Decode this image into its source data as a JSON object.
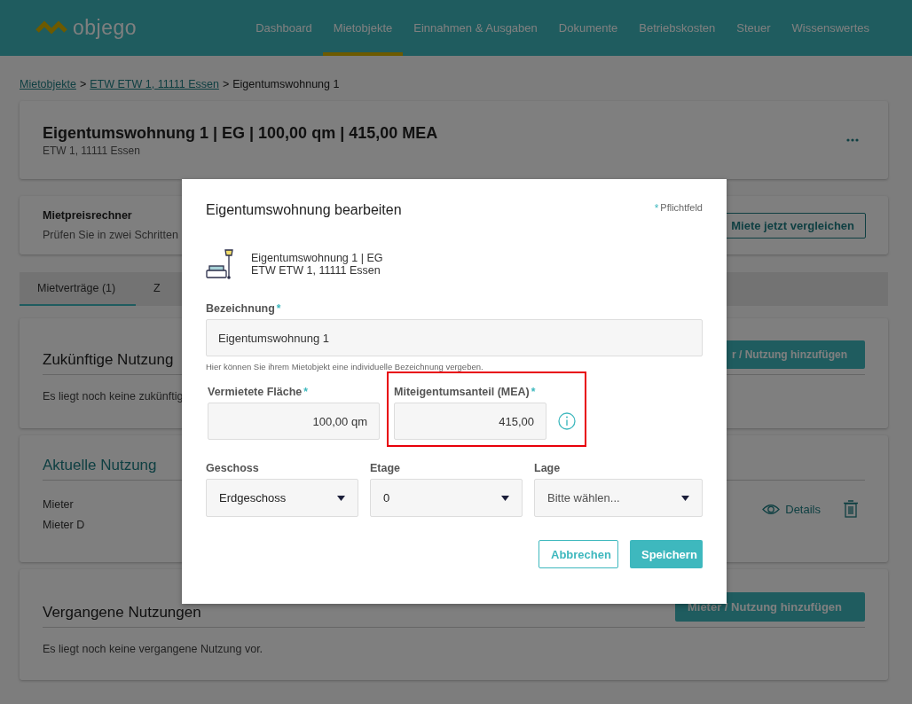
{
  "header": {
    "logo": "objego",
    "nav": [
      {
        "label": "Dashboard",
        "selected": false
      },
      {
        "label": "Mietobjekte",
        "selected": true
      },
      {
        "label": "Einnahmen & Ausgaben",
        "selected": false
      },
      {
        "label": "Dokumente",
        "selected": false
      },
      {
        "label": "Betriebskosten",
        "selected": false
      },
      {
        "label": "Steuer",
        "selected": false
      },
      {
        "label": "Wissenswertes",
        "selected": false
      }
    ]
  },
  "breadcrumb": {
    "separator": ">",
    "links": [
      "Mietobjekte",
      "ETW ETW 1, 11111 Essen"
    ],
    "current": "Eigentumswohnung 1"
  },
  "property": {
    "title": "Eigentumswohnung 1 | EG | 100,00 qm | 415,00 MEA",
    "subtitle": "ETW 1, 11111 Essen"
  },
  "rent_calculator": {
    "title": "Mietpreisrechner",
    "text": "Prüfen Sie in zwei Schritten",
    "button": "Miete jetzt vergleichen"
  },
  "tabs": [
    {
      "label": "Mietverträge (1)",
      "selected": true
    },
    {
      "label": "Z",
      "selected": false
    }
  ],
  "future_usage": {
    "title": "Zukünftige Nutzung",
    "button": "r / Nutzung hinzufügen",
    "empty_text": "Es liegt noch keine zukünftig"
  },
  "current_usage": {
    "title": "Aktuelle Nutzung",
    "label": "Mieter",
    "tenant": "Mieter D",
    "details": "Details"
  },
  "past_usage": {
    "title": "Vergangene Nutzungen",
    "button": "Mieter / Nutzung hinzufügen",
    "empty_text": "Es liegt noch keine vergangene Nutzung vor."
  },
  "dialog": {
    "title": "Eigentumswohnung bearbeiten",
    "required_mark": "*",
    "required_note": "Pflichtfeld",
    "object_name": "Eigentumswohnung 1 | EG",
    "object_address": "ETW ETW 1, 11111 Essen",
    "name_field": {
      "label": "Bezeichnung",
      "required": true,
      "value": "Eigentumswohnung 1",
      "hint": "Hier können Sie ihrem Mietobjekt eine individuelle Bezeichnung vergeben."
    },
    "number_fields": [
      {
        "label": "Vermietete Fläche",
        "required": true,
        "value": "100,00 qm",
        "highlighted": false,
        "info": false
      },
      {
        "label": "Miteigentumsanteil (MEA)",
        "required": true,
        "value": "415,00",
        "highlighted": true,
        "info": true
      }
    ],
    "selects": [
      {
        "label": "Geschoss",
        "value": "Erdgeschoss",
        "placeholder": false
      },
      {
        "label": "Etage",
        "value": "0",
        "placeholder": false
      },
      {
        "label": "Lage",
        "value": "Bitte wählen...",
        "placeholder": true
      }
    ],
    "buttons": [
      {
        "kind": "secondary",
        "label": "Abbrechen"
      },
      {
        "kind": "primary",
        "label": "Speichern"
      }
    ]
  }
}
